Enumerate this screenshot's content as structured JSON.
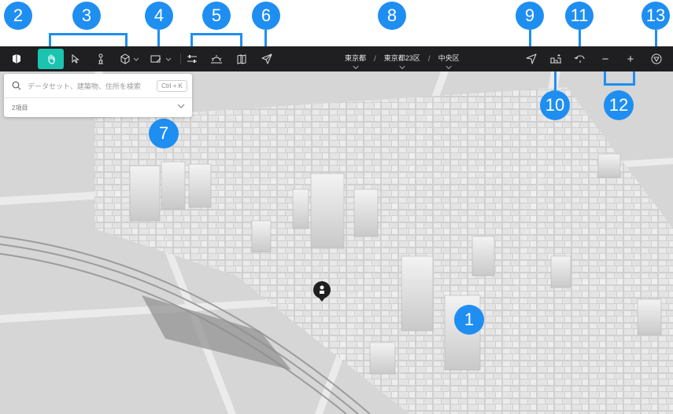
{
  "callouts": [
    "1",
    "2",
    "3",
    "4",
    "5",
    "6",
    "7",
    "8",
    "9",
    "10",
    "11",
    "12",
    "13"
  ],
  "toolbar": {
    "tools": [
      {
        "name": "logo",
        "icon": "plateau-logo-icon"
      },
      {
        "name": "hand",
        "icon": "hand-pan-icon",
        "active": true
      },
      {
        "name": "select",
        "icon": "cursor-select-icon"
      },
      {
        "name": "pedestrian",
        "icon": "pedestrian-icon"
      },
      {
        "name": "model",
        "icon": "cube-icon"
      },
      {
        "name": "sketch",
        "icon": "sketch-tool-icon"
      },
      {
        "name": "settings",
        "icon": "sliders-icon"
      },
      {
        "name": "sun",
        "icon": "sunrise-icon"
      },
      {
        "name": "map",
        "icon": "map-book-icon"
      },
      {
        "name": "share",
        "icon": "share-send-icon"
      }
    ],
    "breadcrumbs": [
      "東京都",
      "東京都23区",
      "中央区"
    ],
    "right": [
      {
        "name": "locate",
        "icon": "location-arrow-icon"
      },
      {
        "name": "streetview",
        "icon": "street-view-icon"
      },
      {
        "name": "reset-north",
        "icon": "rotate-arrow-icon"
      },
      {
        "name": "zoom-out",
        "icon": "minus-icon"
      },
      {
        "name": "zoom-in",
        "icon": "plus-icon"
      },
      {
        "name": "compass",
        "icon": "compass-icon"
      }
    ],
    "zoom_out_label": "−",
    "zoom_in_label": "+"
  },
  "search": {
    "placeholder": "データセット、建築物、住所を検索",
    "shortcut": "Ctrl + K",
    "results_label": "2項目"
  },
  "colors": {
    "accent": "#1f8ef1",
    "toolbar_bg": "#1f1f21",
    "active_tool": "#1bc4b0",
    "map_bg": "#dcdcdc"
  }
}
